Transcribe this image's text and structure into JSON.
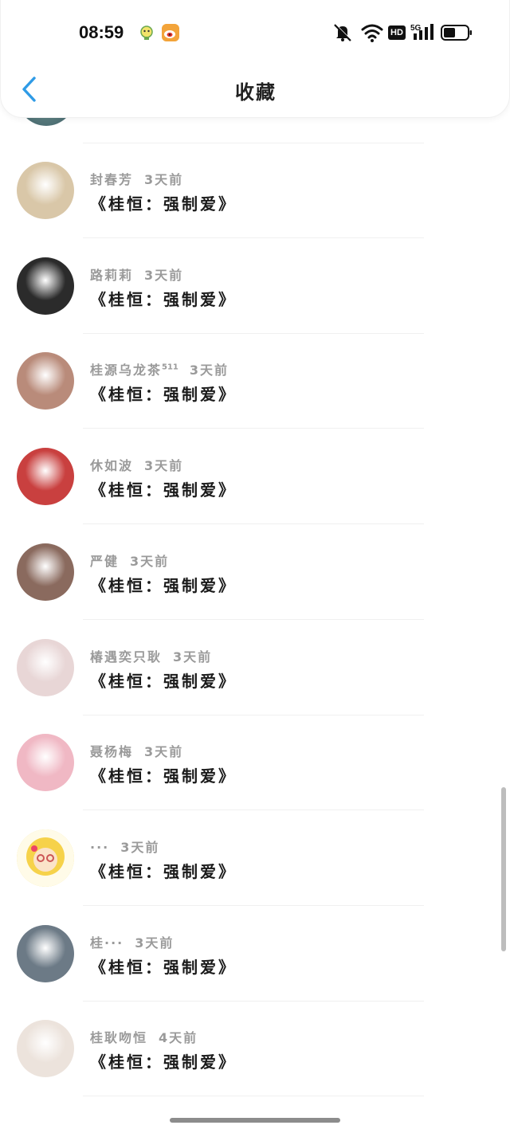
{
  "status_bar": {
    "time": "08:59",
    "hd_label": "HD",
    "network_label": "5G"
  },
  "header": {
    "title": "收藏"
  },
  "items": [
    {
      "name": "封春芳",
      "sup": "",
      "time": "3天前",
      "work": "《桂恒：强制爱》",
      "avatar_color": "#d9c7a8",
      "avatar_icon": "avatar-photo"
    },
    {
      "name": "路莉莉",
      "sup": "",
      "time": "3天前",
      "work": "《桂恒：强制爱》",
      "avatar_color": "#2b2b2b",
      "avatar_icon": "avatar-photo"
    },
    {
      "name": "桂源乌龙茶",
      "sup": "511",
      "time": "3天前",
      "work": "《桂恒：强制爱》",
      "avatar_color": "#b98b7a",
      "avatar_icon": "avatar-photo"
    },
    {
      "name": "休如波",
      "sup": "",
      "time": "3天前",
      "work": "《桂恒：强制爱》",
      "avatar_color": "#c9403f",
      "avatar_icon": "avatar-photo"
    },
    {
      "name": "严健",
      "sup": "",
      "time": "3天前",
      "work": "《桂恒：强制爱》",
      "avatar_color": "#8a6a5e",
      "avatar_icon": "avatar-photo"
    },
    {
      "name": "椿遇奕只耿",
      "sup": "",
      "time": "3天前",
      "work": "《桂恒：强制爱》",
      "avatar_color": "#e8d6d6",
      "avatar_icon": "avatar-photo"
    },
    {
      "name": "聂杨梅",
      "sup": "",
      "time": "3天前",
      "work": "《桂恒：强制爱》",
      "avatar_color": "#f0b8c4",
      "avatar_icon": "avatar-photo"
    },
    {
      "name": "···",
      "sup": "",
      "time": "3天前",
      "work": "《桂恒：强制爱》",
      "avatar_color": "#f6dd6a",
      "avatar_icon": "avatar-cartoon"
    },
    {
      "name": "桂···",
      "sup": "",
      "time": "3天前",
      "work": "《桂恒：强制爱》",
      "avatar_color": "#6c7a86",
      "avatar_icon": "avatar-photo"
    },
    {
      "name": "桂耿吻恒",
      "sup": "",
      "time": "4天前",
      "work": "《桂恒：强制爱》",
      "avatar_color": "#ece3dc",
      "avatar_icon": "avatar-photo"
    }
  ]
}
